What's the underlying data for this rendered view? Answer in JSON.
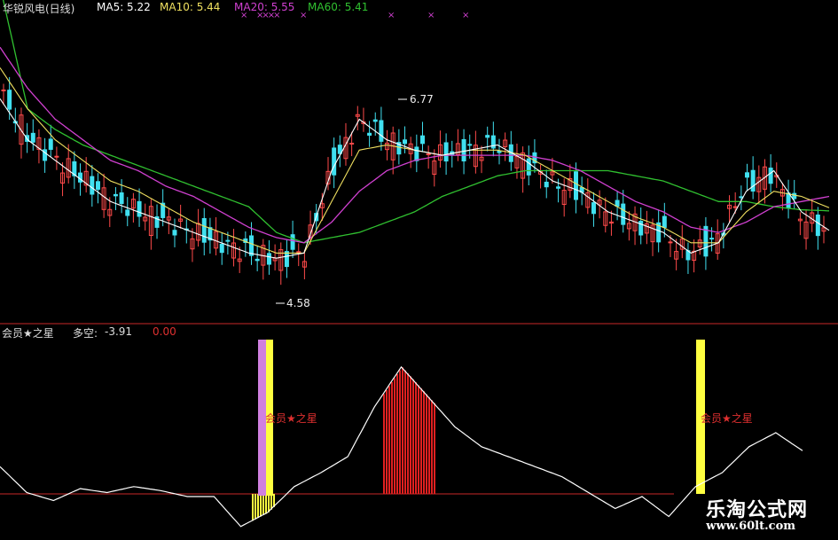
{
  "header": {
    "stock_name": "华锐风电(日线)",
    "ma5": "MA5: 5.22",
    "ma10": "MA10: 5.44",
    "ma20": "MA20: 5.55",
    "ma60": "MA60: 5.41",
    "marks": [
      "×",
      "××××",
      "×",
      "×",
      "×",
      "×"
    ]
  },
  "main_chart": {
    "high_label": "6.77",
    "low_label": "4.58"
  },
  "indicator": {
    "name": "会员★之星",
    "label": "多空:",
    "value": "-3.91",
    "value2": "0.00",
    "signal_label_1": "会员★之星",
    "signal_label_2": "会员★之星"
  },
  "watermark": {
    "brand": "乐淘公式网",
    "url": "www.60lt.com"
  },
  "colors": {
    "up": "#ff4a4a",
    "down": "#40e0f0",
    "ma5": "#ffffff",
    "ma10": "#f0e060",
    "ma20": "#d040d0",
    "ma60": "#30c030",
    "signal": "#ffff40",
    "divider": "#a02020"
  },
  "chart_data": [
    {
      "type": "line",
      "series": [
        {
          "name": "MA5",
          "values": [
            6.5,
            6.1,
            5.9,
            5.7,
            5.5,
            5.4,
            5.3,
            5.2,
            5.1,
            5.0,
            4.95,
            5.0,
            5.8,
            6.3,
            6.1,
            6.0,
            5.95,
            6.0,
            6.05,
            5.9,
            5.7,
            5.6,
            5.4,
            5.3,
            5.2,
            5.0,
            5.1,
            5.6,
            5.8,
            5.4,
            5.22
          ]
        },
        {
          "name": "MA10",
          "values": [
            6.8,
            6.4,
            6.1,
            5.9,
            5.7,
            5.6,
            5.45,
            5.3,
            5.2,
            5.1,
            5.0,
            5.0,
            5.5,
            6.0,
            6.05,
            6.0,
            5.95,
            6.0,
            6.0,
            5.95,
            5.8,
            5.65,
            5.5,
            5.35,
            5.25,
            5.1,
            5.1,
            5.4,
            5.6,
            5.55,
            5.44
          ]
        },
        {
          "name": "MA20",
          "values": [
            7.0,
            6.6,
            6.3,
            6.1,
            5.9,
            5.8,
            5.65,
            5.55,
            5.4,
            5.25,
            5.15,
            5.1,
            5.3,
            5.6,
            5.8,
            5.9,
            5.95,
            5.95,
            5.95,
            5.95,
            5.9,
            5.8,
            5.65,
            5.5,
            5.4,
            5.25,
            5.2,
            5.3,
            5.45,
            5.5,
            5.55
          ]
        },
        {
          "name": "MA60",
          "values": [
            7.6,
            6.4,
            6.2,
            6.05,
            5.95,
            5.85,
            5.75,
            5.65,
            5.55,
            5.45,
            5.2,
            5.1,
            5.15,
            5.2,
            5.3,
            5.4,
            5.55,
            5.65,
            5.75,
            5.8,
            5.8,
            5.8,
            5.8,
            5.75,
            5.7,
            5.6,
            5.5,
            5.5,
            5.45,
            5.42,
            5.41
          ]
        }
      ],
      "ylim": [
        4.4,
        7.2
      ]
    },
    {
      "type": "line",
      "series": [
        {
          "name": "多空",
          "values": [
            -0.5,
            -1.8,
            -2.2,
            -1.6,
            -1.8,
            -1.5,
            -1.7,
            -2.0,
            -2.0,
            -3.5,
            -2.8,
            -1.5,
            -0.8,
            0.0,
            2.5,
            4.5,
            3.0,
            1.5,
            0.5,
            0.0,
            -0.5,
            -1.0,
            -1.8,
            -2.6,
            -2.0,
            -3.0,
            -1.5,
            -0.8,
            0.5,
            1.2,
            0.3
          ]
        }
      ],
      "ylim": [
        -4,
        6
      ],
      "signals": [
        0.32,
        0.84
      ]
    }
  ]
}
